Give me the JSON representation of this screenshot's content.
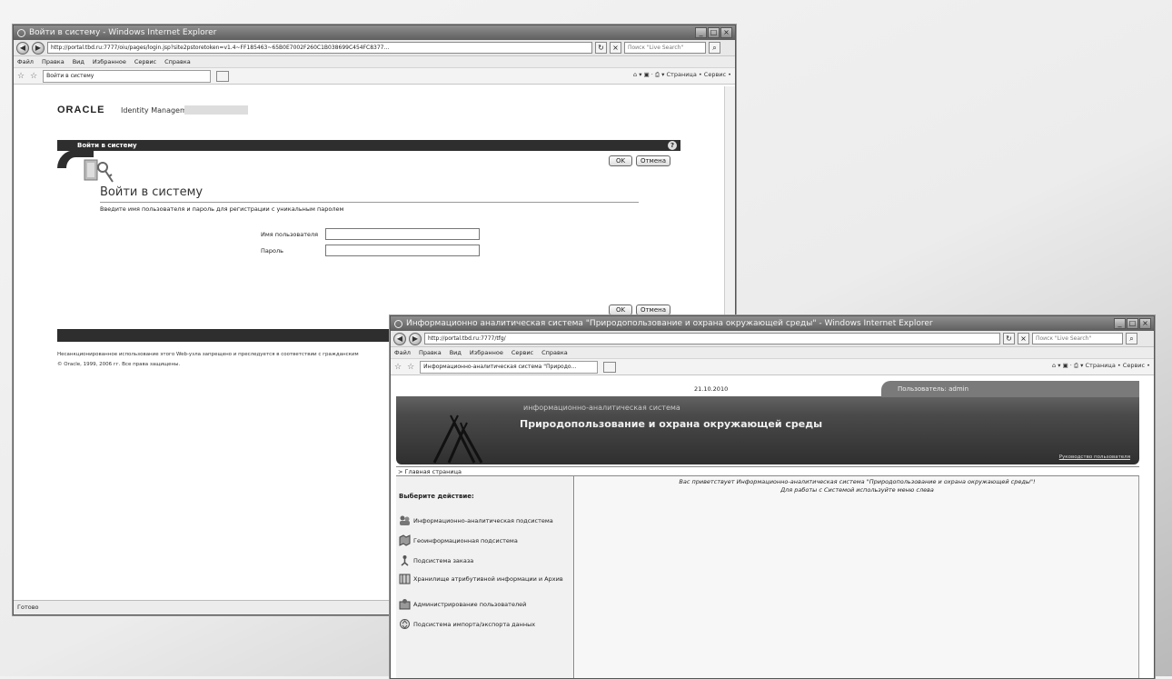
{
  "window1": {
    "title": "Войти в систему - Windows Internet Explorer",
    "url": "http://portal.tbd.ru:7777/oiu/pages/login.jsp?site2pstoretoken=v1.4~FF185463~65B0E7002F260C1B038699C454FC8377...",
    "search_placeholder": "Поиск \"Live Search\"",
    "menu": [
      "Файл",
      "Правка",
      "Вид",
      "Избранное",
      "Сервис",
      "Справка"
    ],
    "tab_label": "Войти в систему",
    "commands": "Страница • Сервис •",
    "status": "Готово",
    "page": {
      "logo": "ORACLE",
      "logo_sub": "Identity Management",
      "header": "Войти в систему",
      "title": "Войти в систему",
      "instructions": "Введите имя пользователя и пароль для регистрации с уникальным паролем",
      "username_label": "Имя пользователя",
      "password_label": "Пароль",
      "ok": "OK",
      "cancel": "Отмена",
      "legal_1": "Несанкционированное использование этого Web-узла запрещено и преследуется в соответствии с гражданским",
      "legal_2": "© Oracle, 1999, 2006 гг. Все права защищены."
    }
  },
  "window2": {
    "title": "Информационно аналитическая система \"Природопользование и охрана окружающей среды\" - Windows Internet Explorer",
    "url": "http://portal.tbd.ru:7777/tfg/",
    "search_placeholder": "Поиск \"Live Search\"",
    "menu": [
      "Файл",
      "Правка",
      "Вид",
      "Избранное",
      "Сервис",
      "Справка"
    ],
    "tab_label": "Информационно-аналитическая система \"Природо...",
    "commands": "Страница • Сервис •",
    "page": {
      "date": "21.10.2010",
      "user": "Пользователь: admin",
      "subtitle": "информационно-аналитическая система",
      "title": "Природопользование и охрана окружающей среды",
      "guide_link": "Руководство пользователя",
      "breadcrumb": "> Главная страница",
      "choose_action": "Выберите действие:",
      "menu_items": [
        {
          "label": "Информационно-аналитическая подсистема",
          "icon": "people-icon"
        },
        {
          "label": "Геоинформационная подсистема",
          "icon": "map-icon"
        },
        {
          "label": "Подсистема заказа",
          "icon": "person-icon"
        },
        {
          "label": "Хранилище атрибутивной информации и Архив",
          "icon": "archive-icon"
        },
        {
          "label": "Администрирование пользователей",
          "icon": "users-admin-icon"
        },
        {
          "label": "Подсистема импорта/экспорта данных",
          "icon": "import-export-icon"
        }
      ],
      "welcome_1": "Вас приветствует Информационно-аналитическая система \"Природопользование и охрана окружающей среды\"!",
      "welcome_2": "Для работы с Системой используйте меню слева"
    }
  }
}
